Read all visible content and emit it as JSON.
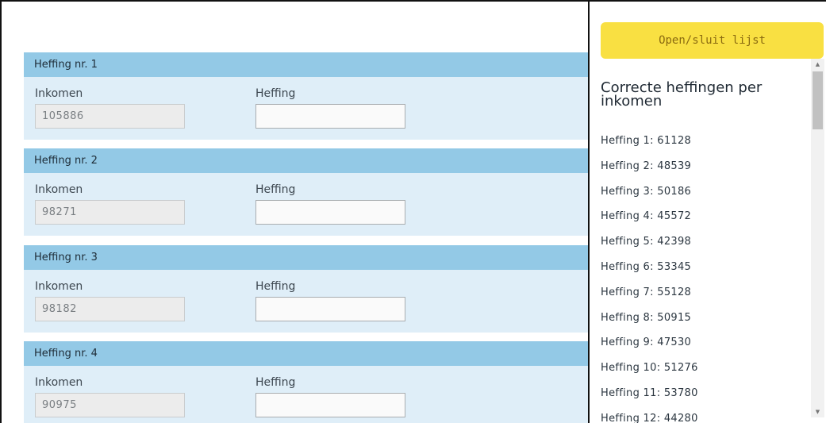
{
  "form": {
    "cards": [
      {
        "header": "Heffing nr. 1",
        "inkomen_label": "Inkomen",
        "heffing_label": "Heffing",
        "inkomen_value": "105886",
        "heffing_value": ""
      },
      {
        "header": "Heffing nr. 2",
        "inkomen_label": "Inkomen",
        "heffing_label": "Heffing",
        "inkomen_value": "98271",
        "heffing_value": ""
      },
      {
        "header": "Heffing nr. 3",
        "inkomen_label": "Inkomen",
        "heffing_label": "Heffing",
        "inkomen_value": "98182",
        "heffing_value": ""
      },
      {
        "header": "Heffing nr. 4",
        "inkomen_label": "Inkomen",
        "heffing_label": "Heffing",
        "inkomen_value": "90975",
        "heffing_value": ""
      }
    ]
  },
  "sidebar": {
    "toggle_label": "Open/sluit lijst",
    "title": "Correcte heffingen per inkomen",
    "items": [
      "Heffing 1: 61128",
      "Heffing 2: 48539",
      "Heffing 3: 50186",
      "Heffing 4: 45572",
      "Heffing 5: 42398",
      "Heffing 6: 53345",
      "Heffing 7: 55128",
      "Heffing 8: 50915",
      "Heffing 9: 47530",
      "Heffing 10: 51276",
      "Heffing 11: 53780",
      "Heffing 12: 44280"
    ]
  },
  "colors": {
    "card_header": "#93c9e6",
    "card_body": "#dfeef8",
    "toggle_button": "#f9e042",
    "toggle_text": "#8a6a10"
  },
  "icons": {
    "scroll_up": "triangle-up-icon",
    "scroll_down": "triangle-down-icon"
  }
}
